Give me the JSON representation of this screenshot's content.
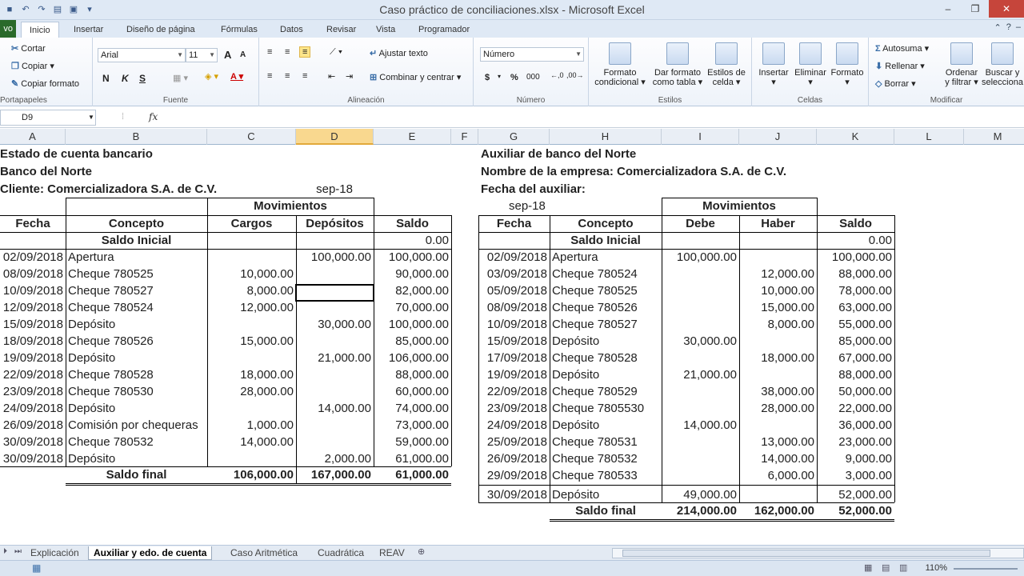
{
  "window": {
    "title": "Caso práctico de conciliaciones.xlsx - Microsoft Excel",
    "quick_access": [
      "save-icon",
      "undo-icon",
      "redo-icon",
      "open-icon",
      "print-icon",
      "customize-icon"
    ]
  },
  "ribbon_tabs": {
    "file": "vo",
    "tabs": [
      "Inicio",
      "Insertar",
      "Diseño de página",
      "Fórmulas",
      "Datos",
      "Revisar",
      "Vista",
      "Programador"
    ],
    "active": "Inicio"
  },
  "ribbon": {
    "clipboard": {
      "cut": "Cortar",
      "copy": "Copiar",
      "format_painter": "Copiar formato",
      "label": "Portapapeles"
    },
    "font": {
      "name": "Arial",
      "size": "11",
      "bold": "N",
      "italic": "K",
      "underline": "S",
      "label": "Fuente",
      "grow": "A",
      "shrink": "A"
    },
    "alignment": {
      "wrap": "Ajustar texto",
      "merge": "Combinar y centrar",
      "label": "Alineación"
    },
    "number": {
      "format": "Número",
      "currency": "$",
      "percent": "%",
      "thousands": "000",
      "label": "Número"
    },
    "styles": {
      "conditional_l1": "Formato",
      "conditional_l2": "condicional",
      "table_l1": "Dar formato",
      "table_l2": "como tabla",
      "cell_l1": "Estilos de",
      "cell_l2": "celda",
      "label": "Estilos"
    },
    "cells": {
      "insert": "Insertar",
      "delete": "Eliminar",
      "format": "Formato",
      "label": "Celdas"
    },
    "editing": {
      "autosum": "Autosuma",
      "fill": "Rellenar",
      "clear": "Borrar",
      "sort_l1": "Ordenar",
      "sort_l2": "y filtrar",
      "find_l1": "Buscar y",
      "find_l2": "selecciona",
      "label": "Modificar"
    }
  },
  "formula_bar": {
    "name_box": "D9",
    "fx": "fx",
    "content": ""
  },
  "columns": [
    "A",
    "B",
    "C",
    "D",
    "E",
    "F",
    "G",
    "H",
    "I",
    "J",
    "K",
    "L",
    "M"
  ],
  "selected_column": "D",
  "bank": {
    "title": "Estado de cuenta bancario",
    "bank_name": "Banco del Norte",
    "client": "Cliente: Comercializadora S.A. de C.V.",
    "period": "sep-18",
    "movimientos": "Movimientos",
    "headers": [
      "Fecha",
      "Concepto",
      "Cargos",
      "Depósitos",
      "Saldo"
    ],
    "opening": {
      "label": "Saldo Inicial",
      "saldo": "0.00"
    },
    "rows": [
      [
        "02/09/2018",
        "Apertura",
        "",
        "100,000.00",
        "100,000.00"
      ],
      [
        "08/09/2018",
        "Cheque 780525",
        "10,000.00",
        "",
        "90,000.00"
      ],
      [
        "10/09/2018",
        "Cheque 780527",
        "8,000.00",
        "",
        "82,000.00"
      ],
      [
        "12/09/2018",
        "Cheque 780524",
        "12,000.00",
        "",
        "70,000.00"
      ],
      [
        "15/09/2018",
        "Depósito",
        "",
        "30,000.00",
        "100,000.00"
      ],
      [
        "18/09/2018",
        "Cheque 780526",
        "15,000.00",
        "",
        "85,000.00"
      ],
      [
        "19/09/2018",
        "Depósito",
        "",
        "21,000.00",
        "106,000.00"
      ],
      [
        "22/09/2018",
        "Cheque 780528",
        "18,000.00",
        "",
        "88,000.00"
      ],
      [
        "23/09/2018",
        "Cheque 780530",
        "28,000.00",
        "",
        "60,000.00"
      ],
      [
        "24/09/2018",
        "Depósito",
        "",
        "14,000.00",
        "74,000.00"
      ],
      [
        "26/09/2018",
        "Comisión por chequeras",
        "1,000.00",
        "",
        "73,000.00"
      ],
      [
        "30/09/2018",
        "Cheque 780532",
        "14,000.00",
        "",
        "59,000.00"
      ],
      [
        "30/09/2018",
        "Depósito",
        "",
        "2,000.00",
        "61,000.00"
      ]
    ],
    "final": {
      "label": "Saldo final",
      "cargos": "106,000.00",
      "depositos": "167,000.00",
      "saldo": "61,000.00"
    }
  },
  "ledger": {
    "title": "Auxiliar de banco del Norte",
    "company": "Nombre de la empresa: Comercializadora S.A. de C.V.",
    "date_label": "Fecha del auxiliar:",
    "period": "sep-18",
    "movimientos": "Movimientos",
    "headers": [
      "Fecha",
      "Concepto",
      "Debe",
      "Haber",
      "Saldo"
    ],
    "opening": {
      "label": "Saldo Inicial",
      "saldo": "0.00"
    },
    "rows": [
      [
        "02/09/2018",
        "Apertura",
        "100,000.00",
        "",
        "100,000.00"
      ],
      [
        "03/09/2018",
        "Cheque 780524",
        "",
        "12,000.00",
        "88,000.00"
      ],
      [
        "05/09/2018",
        "Cheque 780525",
        "",
        "10,000.00",
        "78,000.00"
      ],
      [
        "08/09/2018",
        "Cheque 780526",
        "",
        "15,000.00",
        "63,000.00"
      ],
      [
        "10/09/2018",
        "Cheque 780527",
        "",
        "8,000.00",
        "55,000.00"
      ],
      [
        "15/09/2018",
        "Depósito",
        "30,000.00",
        "",
        "85,000.00"
      ],
      [
        "17/09/2018",
        "Cheque 780528",
        "",
        "18,000.00",
        "67,000.00"
      ],
      [
        "19/09/2018",
        "Depósito",
        "21,000.00",
        "",
        "88,000.00"
      ],
      [
        "22/09/2018",
        "Cheque 780529",
        "",
        "38,000.00",
        "50,000.00"
      ],
      [
        "23/09/2018",
        "Cheque 7805530",
        "",
        "28,000.00",
        "22,000.00"
      ],
      [
        "24/09/2018",
        "Depósito",
        "14,000.00",
        "",
        "36,000.00"
      ],
      [
        "25/09/2018",
        "Cheque 780531",
        "",
        "13,000.00",
        "23,000.00"
      ],
      [
        "26/09/2018",
        "Cheque 780532",
        "",
        "14,000.00",
        "9,000.00"
      ],
      [
        "29/09/2018",
        "Cheque 780533",
        "",
        "6,000.00",
        "3,000.00"
      ],
      [
        "30/09/2018",
        "Depósito",
        "49,000.00",
        "",
        "52,000.00"
      ]
    ],
    "final": {
      "label": "Saldo final",
      "debe": "214,000.00",
      "haber": "162,000.00",
      "saldo": "52,000.00"
    }
  },
  "sheet_tabs": {
    "tabs": [
      "Explicación",
      "Auxiliar y edo. de cuenta",
      "Caso Aritmética",
      "Cuadrática",
      "REAV"
    ],
    "active": "Auxiliar y edo. de cuenta"
  },
  "status": {
    "zoom": "110%"
  }
}
